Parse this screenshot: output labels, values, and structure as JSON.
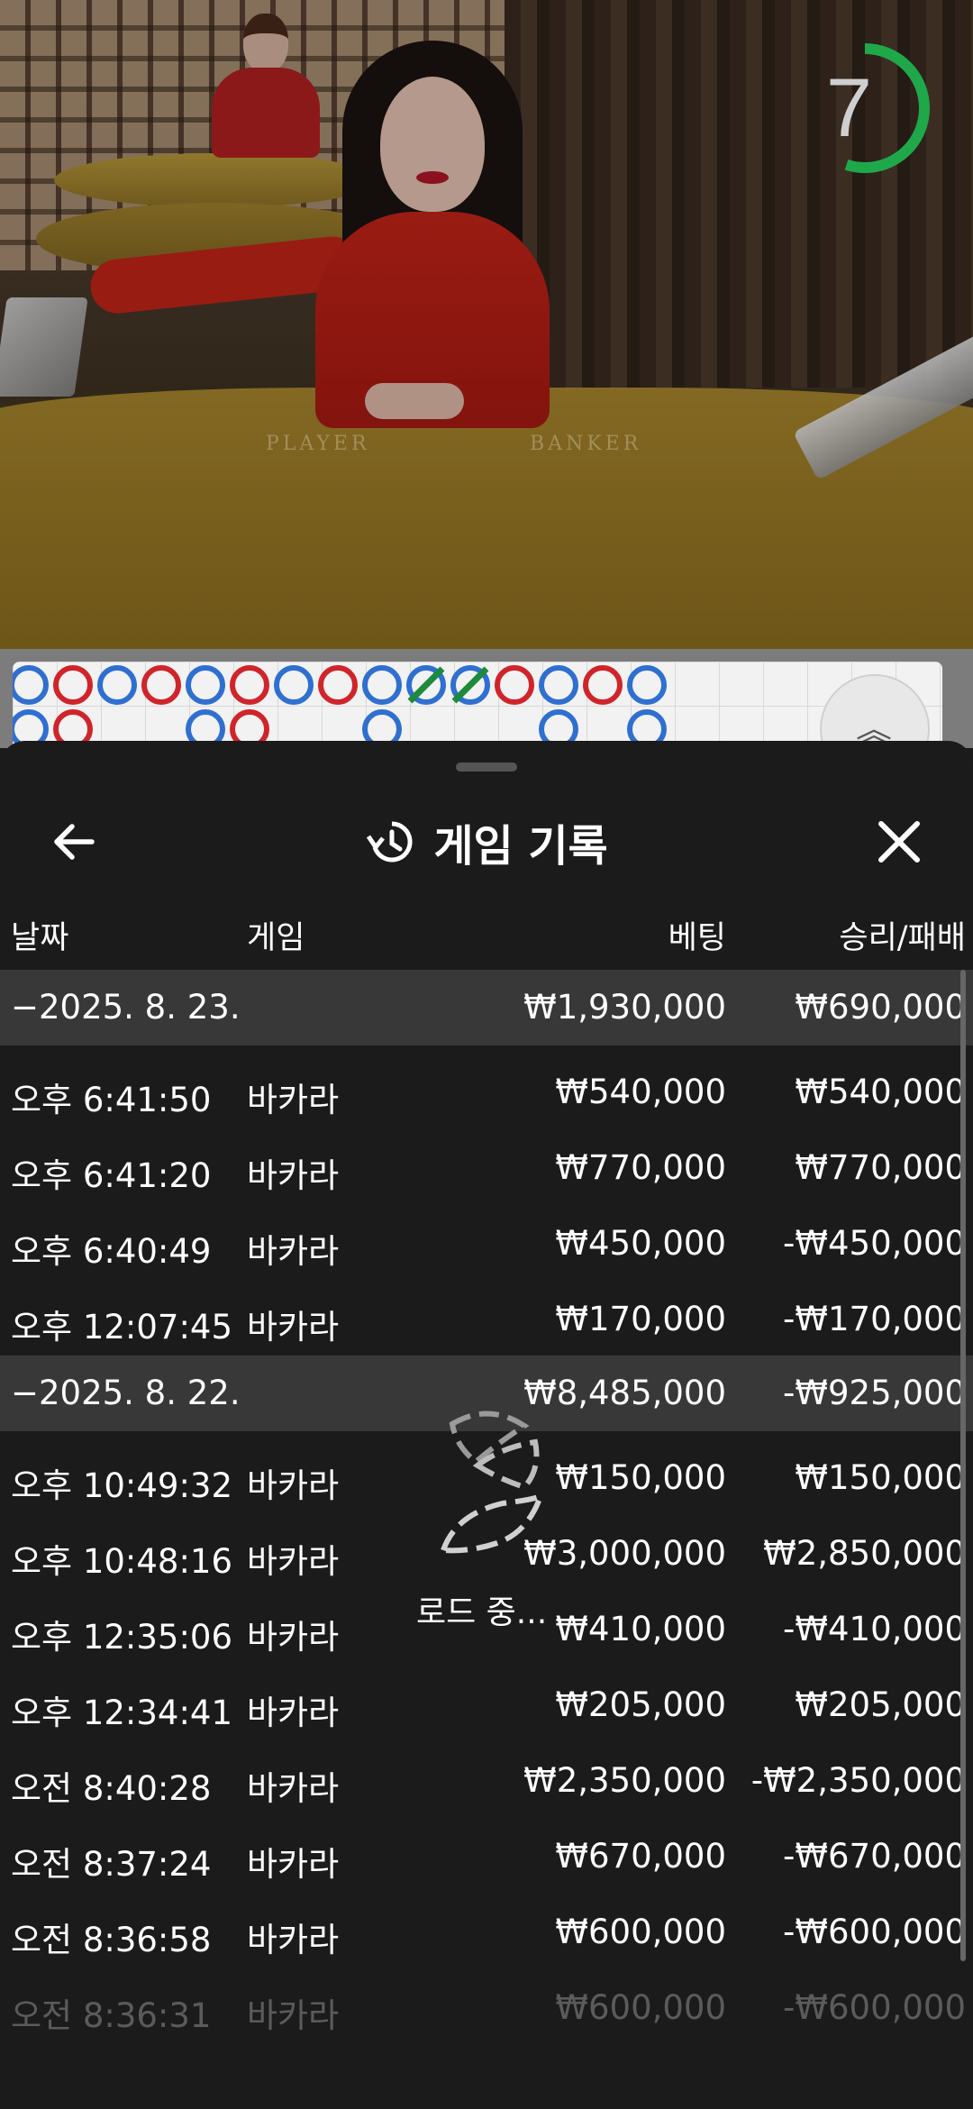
{
  "timer": {
    "value": "7",
    "progress": 0.55,
    "color": "#1fa84a"
  },
  "felt": {
    "player": "PLAYER",
    "banker": "BANKER"
  },
  "bead_road": {
    "colors": {
      "player": "#2f6fd0",
      "banker": "#d0242b",
      "tie": "#1d8a3c"
    },
    "row1": [
      "P",
      "B",
      "P",
      "B",
      "P",
      "B",
      "P",
      "B",
      "P",
      "T",
      "T",
      "B",
      "P",
      "B",
      "P"
    ],
    "row2": [
      "P",
      "B",
      "",
      "",
      "P",
      "B",
      "",
      "",
      "P",
      "",
      "",
      "",
      "P",
      "",
      "P"
    ]
  },
  "sheet": {
    "title": "게임 기록",
    "back_icon": "arrow-left-icon",
    "history_icon": "history-icon",
    "close_icon": "close-icon",
    "columns": {
      "date": "날짜",
      "game": "게임",
      "bet": "베팅",
      "winloss": "승리/패배"
    },
    "groups": [
      {
        "date": "−2025. 8. 23.",
        "bet_total": "₩1,930,000",
        "wl_total": "₩690,000",
        "rows": [
          {
            "time": "오후 6:41:50",
            "game": "바카라",
            "bet": "₩540,000",
            "wl": "₩540,000"
          },
          {
            "time": "오후 6:41:20",
            "game": "바카라",
            "bet": "₩770,000",
            "wl": "₩770,000"
          },
          {
            "time": "오후 6:40:49",
            "game": "바카라",
            "bet": "₩450,000",
            "wl": "-₩450,000"
          },
          {
            "time": "오후 12:07:45",
            "game": "바카라",
            "bet": "₩170,000",
            "wl": "-₩170,000"
          }
        ]
      },
      {
        "date": "−2025. 8. 22.",
        "bet_total": "₩8,485,000",
        "wl_total": "-₩925,000",
        "rows": [
          {
            "time": "오후 10:49:32",
            "game": "바카라",
            "bet": "₩150,000",
            "wl": "₩150,000"
          },
          {
            "time": "오후 10:48:16",
            "game": "바카라",
            "bet": "₩3,000,000",
            "wl": "₩2,850,000"
          },
          {
            "time": "오후 12:35:06",
            "game": "바카라",
            "bet": "₩410,000",
            "wl": "-₩410,000"
          },
          {
            "time": "오후 12:34:41",
            "game": "바카라",
            "bet": "₩205,000",
            "wl": "₩205,000"
          },
          {
            "time": "오전 8:40:28",
            "game": "바카라",
            "bet": "₩2,350,000",
            "wl": "-₩2,350,000"
          },
          {
            "time": "오전 8:37:24",
            "game": "바카라",
            "bet": "₩670,000",
            "wl": "-₩670,000"
          },
          {
            "time": "오전 8:36:58",
            "game": "바카라",
            "bet": "₩600,000",
            "wl": "-₩600,000"
          },
          {
            "time": "오전 8:36:31",
            "game": "바카라",
            "bet": "₩600,000",
            "wl": "-₩600,000"
          }
        ]
      }
    ],
    "loading_text": "로드 중..."
  }
}
